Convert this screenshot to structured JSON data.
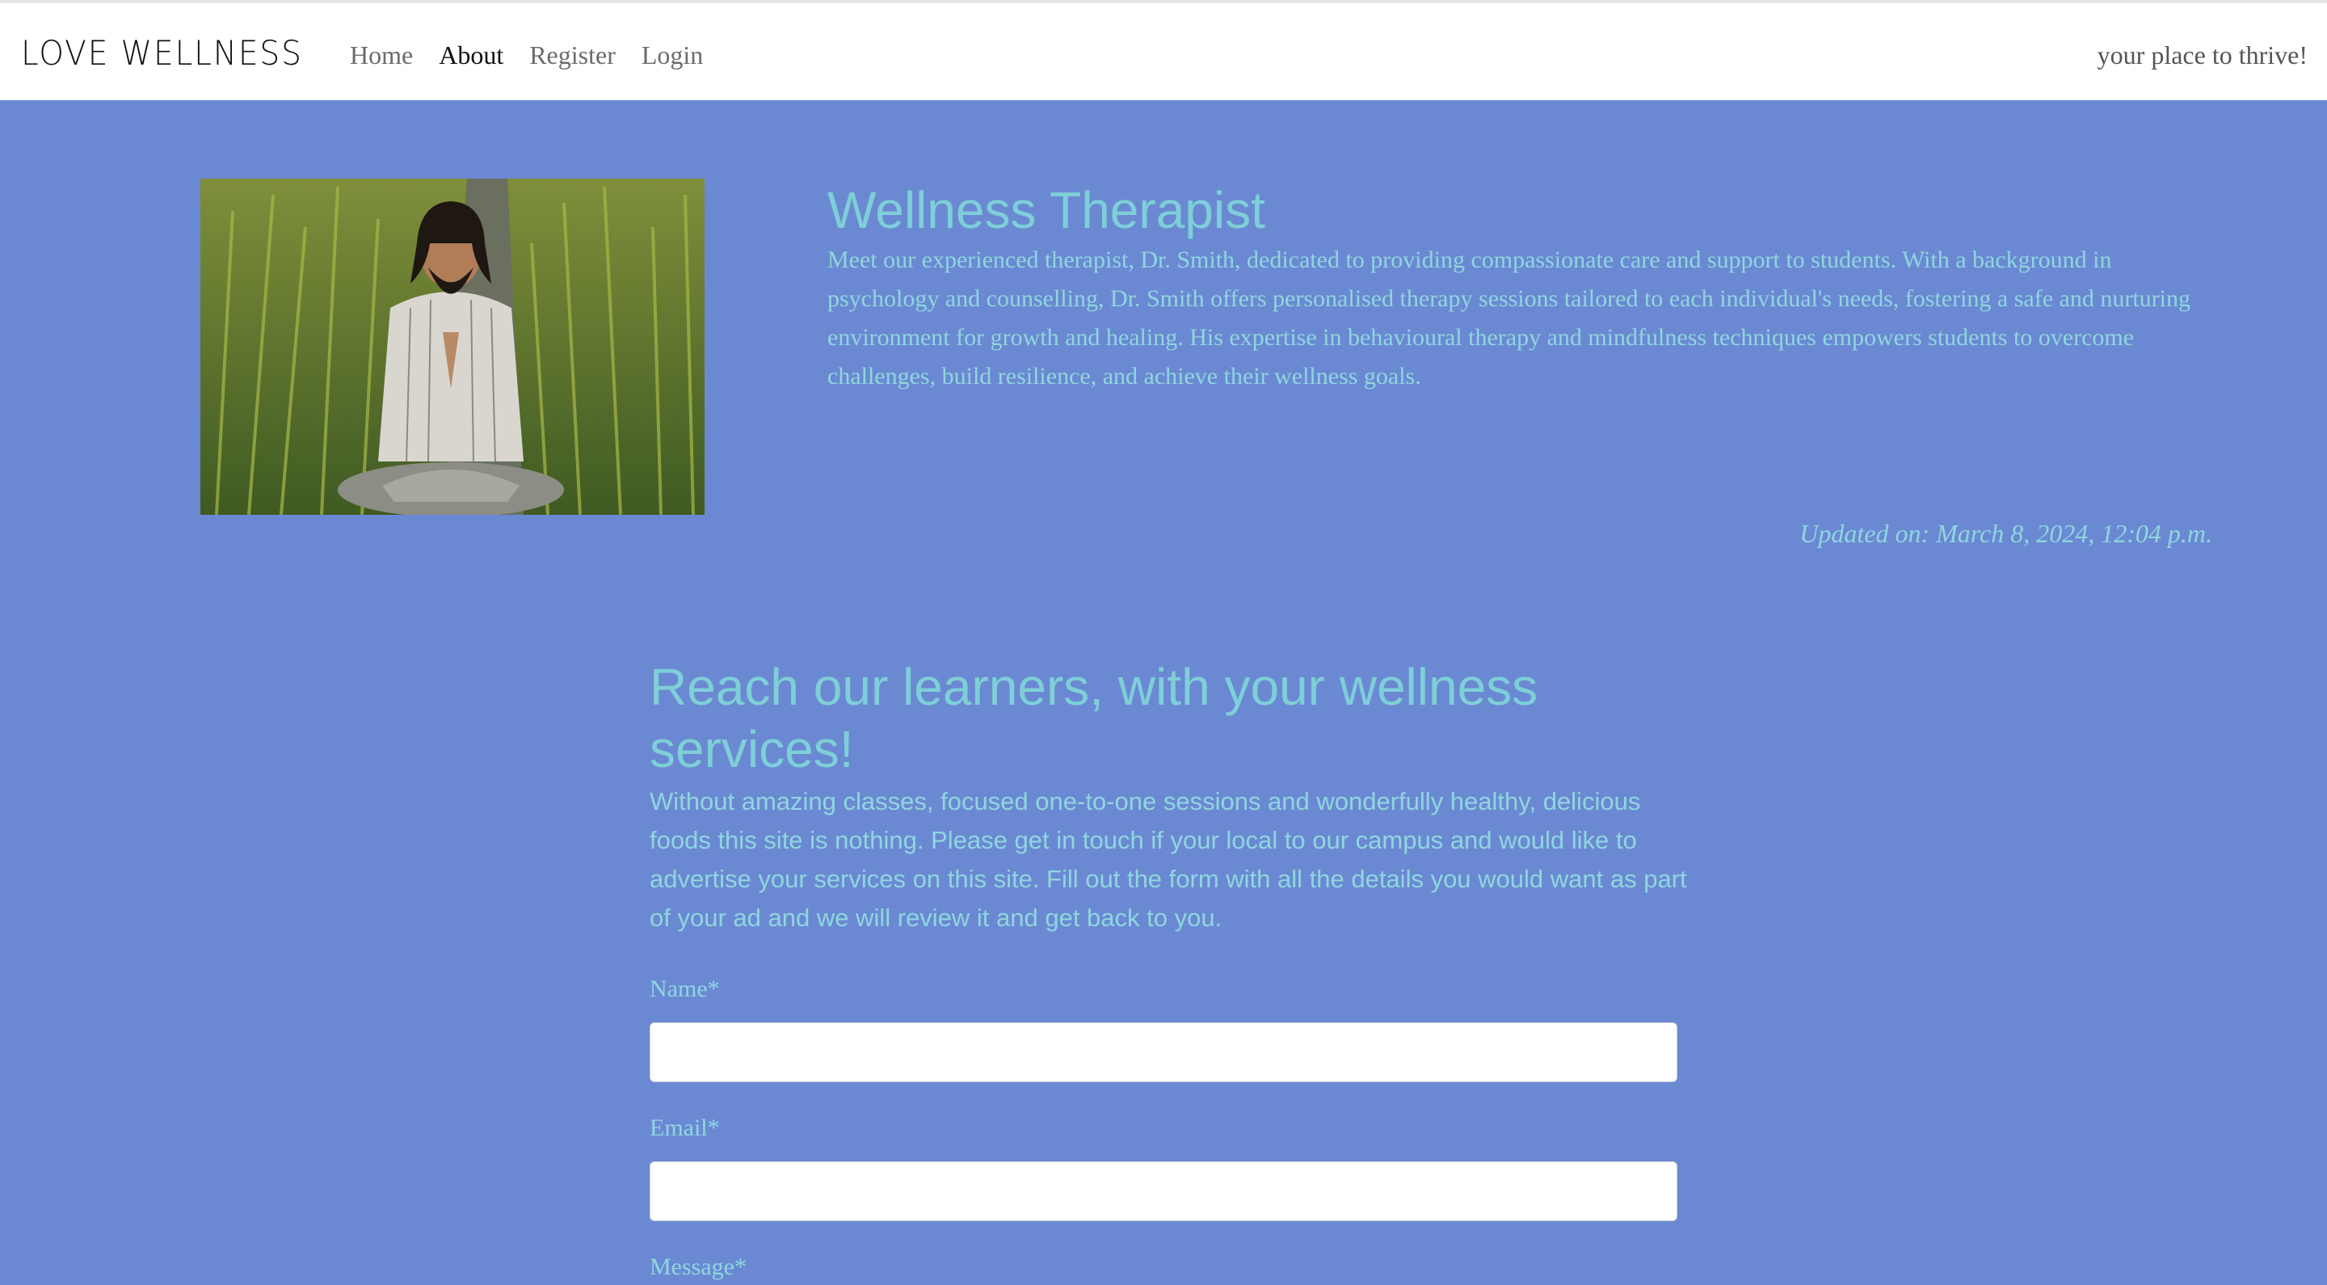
{
  "nav": {
    "brand": "LOVE WELLNESS",
    "links": [
      "Home",
      "About",
      "Register",
      "Login"
    ],
    "active": "About",
    "tagline": "your place to thrive!"
  },
  "therapist": {
    "title": "Wellness Therapist",
    "description": "Meet our experienced therapist, Dr. Smith, dedicated to providing compassionate care and support to students. With a background in psychology and counselling, Dr. Smith offers personalised therapy sessions tailored to each individual's needs, fostering a safe and nurturing environment for growth and healing. His expertise in behavioural therapy and mindfulness techniques empowers students to overcome challenges, build resilience, and achieve their wellness goals.",
    "updated": "Updated on: March 8, 2024, 12:04 p.m."
  },
  "reach": {
    "title": "Reach our learners, with your wellness services!",
    "description": "Without amazing classes, focused one-to-one sessions and wonderfully healthy, delicious foods this site is nothing. Please get in touch if your local to our campus and would like to advertise your services on this site. Fill out the form with all the details you would want as part of your ad and we will review it and get back to you."
  },
  "form": {
    "name_label": "Name*",
    "name_value": "",
    "email_label": "Email*",
    "email_value": "",
    "message_label": "Message*"
  },
  "colors": {
    "background": "#6b89d2",
    "heading": "#7ecfd8",
    "body_text": "#8fd6df",
    "navbar": "#ffffff"
  }
}
